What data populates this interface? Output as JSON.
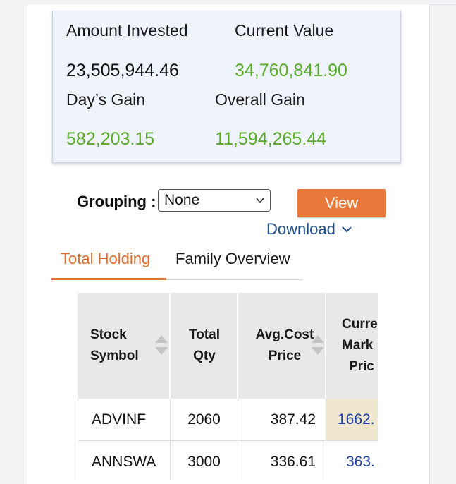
{
  "summary": {
    "amount_invested_label": "Amount Invested",
    "amount_invested_value": "23,505,944.46",
    "current_value_label": "Current Value",
    "current_value_value": "34,760,841.90",
    "days_gain_label": "Day’s Gain",
    "days_gain_value": "582,203.15",
    "overall_gain_label": "Overall Gain",
    "overall_gain_value": "11,594,265.44",
    "positive_color": "#5aab2a"
  },
  "controls": {
    "grouping_label": "Grouping :",
    "grouping_selected": "None",
    "view_label": "View",
    "download_label": "Download"
  },
  "tabs": [
    {
      "label": "Total Holding",
      "active": true
    },
    {
      "label": "Family Overview",
      "active": false
    }
  ],
  "table": {
    "headers": {
      "symbol": [
        "Stock",
        "Symbol"
      ],
      "qty": [
        "Total",
        "Qty"
      ],
      "avg": [
        "Avg.Cost",
        "Price"
      ],
      "cmp": [
        "Curre",
        "Mark",
        "Pric"
      ]
    },
    "rows": [
      {
        "symbol": "ADVINF",
        "qty": "2060",
        "avg": "387.42",
        "cmp": "1662."
      },
      {
        "symbol": "ANNSWA",
        "qty": "3000",
        "avg": "336.61",
        "cmp": "363."
      }
    ]
  },
  "colors": {
    "accent": "#e8793a",
    "link": "#1f4e8c",
    "highlight": "#efe8cf"
  }
}
